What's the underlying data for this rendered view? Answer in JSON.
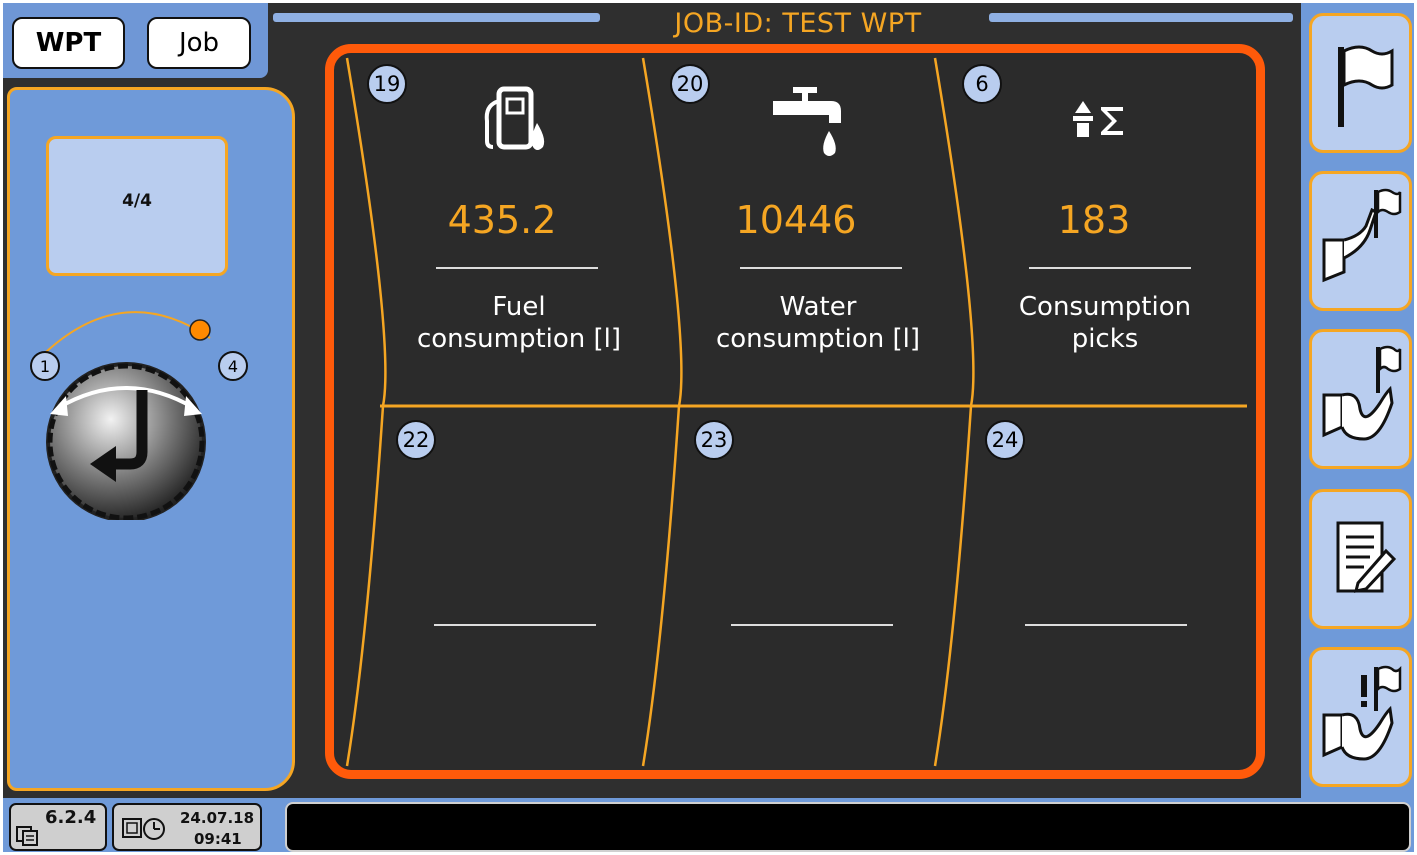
{
  "header": {
    "tabs": [
      {
        "label": "WPT"
      },
      {
        "label": "Job"
      }
    ],
    "job_id": "JOB-ID: TEST WPT"
  },
  "left": {
    "page_indicator": "4/4",
    "dial": {
      "min_label": "1",
      "max_label": "4",
      "position_fraction": 1.0
    }
  },
  "tiles": [
    {
      "number": "19",
      "icon": "fuel-pump-icon",
      "value": "435.2",
      "label_line1": "Fuel",
      "label_line2": "consumption [l]"
    },
    {
      "number": "20",
      "icon": "water-tap-icon",
      "value": "10446",
      "label_line1": "Water",
      "label_line2": "consumption [l]"
    },
    {
      "number": "6",
      "icon": "pick-sum-icon",
      "value": "183",
      "label_line1": "Consumption",
      "label_line2": "picks"
    },
    {
      "number": "22",
      "icon": "",
      "value": "",
      "label_line1": "",
      "label_line2": ""
    },
    {
      "number": "23",
      "icon": "",
      "value": "",
      "label_line1": "",
      "label_line2": ""
    },
    {
      "number": "24",
      "icon": "",
      "value": "",
      "label_line1": "",
      "label_line2": ""
    }
  ],
  "right_buttons": [
    {
      "icon": "flag-icon"
    },
    {
      "icon": "flag-path-icon"
    },
    {
      "icon": "flag-wave-path-icon"
    },
    {
      "icon": "notepad-edit-icon"
    },
    {
      "icon": "flag-alert-icon"
    }
  ],
  "footer": {
    "version": "6.2.4",
    "date": "24.07.18",
    "time": "09:41"
  },
  "colors": {
    "accent": "#f5a623",
    "frame": "#ff5a0a",
    "panel": "#6f9ad9",
    "background": "#2f2f2f"
  }
}
